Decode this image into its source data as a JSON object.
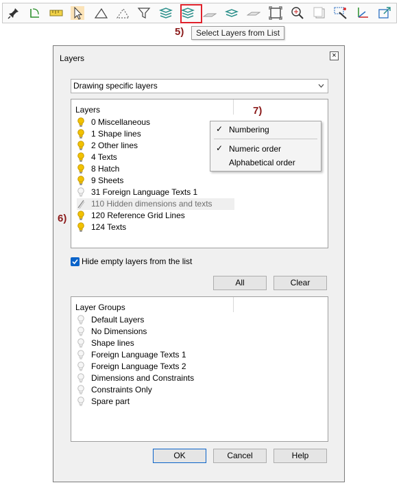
{
  "callouts": {
    "step5": "5)",
    "step6": "6)",
    "step7": "7)"
  },
  "tooltip": "Select Layers from List",
  "toolbar": {
    "icons": [
      "pin-icon",
      "rotate-corner-icon",
      "ruler-icon",
      "pointer-icon",
      "triangle-icon",
      "dashed-triangle-icon",
      "filter-icon",
      "layers-stack-icon",
      "select-layers-list-icon",
      "flat-plane-icon",
      "layers-alt-icon",
      "plane-outline-icon",
      "frame-icon",
      "zoom-in-icon",
      "copy-frame-icon",
      "magic-select-icon",
      "axes-icon",
      "export-icon"
    ]
  },
  "dialog": {
    "title": "Layers",
    "close": "×",
    "dropdown_value": "Drawing specific layers",
    "layers_header": "Layers",
    "layers": [
      {
        "label": "0 Miscellaneous",
        "state": "on"
      },
      {
        "label": "1 Shape lines",
        "state": "on"
      },
      {
        "label": "2 Other lines",
        "state": "on"
      },
      {
        "label": "4 Texts",
        "state": "on"
      },
      {
        "label": "8 Hatch",
        "state": "on"
      },
      {
        "label": "9 Sheets",
        "state": "on"
      },
      {
        "label": "31 Foreign Language Texts 1",
        "state": "off"
      },
      {
        "label": "110 Hidden dimensions and texts",
        "state": "hidden"
      },
      {
        "label": "120 Reference Grid Lines",
        "state": "on"
      },
      {
        "label": "124 Texts",
        "state": "on"
      }
    ],
    "hide_empty_label": "Hide empty layers from the list",
    "hide_empty_checked": true,
    "all_button": "All",
    "clear_button": "Clear",
    "groups_header": "Layer Groups",
    "groups": [
      "Default Layers",
      "No Dimensions",
      "Shape lines",
      "Foreign Language Texts 1",
      "Foreign Language Texts 2",
      "Dimensions and Constraints",
      "Constraints Only",
      "Spare part"
    ],
    "ok_button": "OK",
    "cancel_button": "Cancel",
    "help_button": "Help"
  },
  "context_menu": {
    "items": [
      {
        "label": "Numbering",
        "checked": true
      },
      {
        "label": "Numeric order",
        "checked": true
      },
      {
        "label": "Alphabetical order",
        "checked": false
      }
    ],
    "check_glyph": "✓"
  },
  "colors": {
    "bulb_on": "#f2c200",
    "bulb_off": "#d8d8d8",
    "accent": "#0a63c9",
    "callout": "#8b1a1a",
    "highlight": "#e0202a"
  }
}
